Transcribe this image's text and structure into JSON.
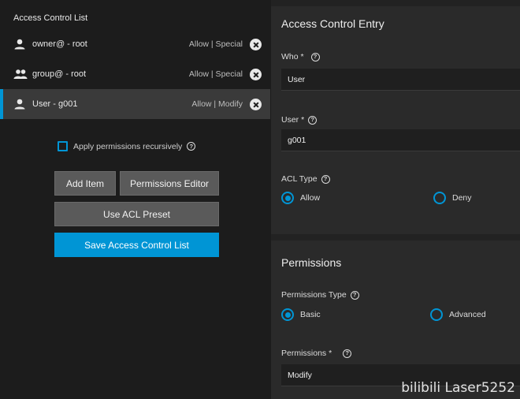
{
  "left": {
    "title": "Access Control List",
    "items": [
      {
        "name": "owner@ - root",
        "perm": "Allow | Special",
        "icon": "person-icon"
      },
      {
        "name": "group@ - root",
        "perm": "Allow | Special",
        "icon": "group-icon"
      },
      {
        "name": "User - g001",
        "perm": "Allow | Modify",
        "icon": "person-icon"
      }
    ],
    "recursive_label": "Apply permissions recursively",
    "buttons": {
      "add_item": "Add Item",
      "permissions_editor": "Permissions Editor",
      "use_acl_preset": "Use ACL Preset",
      "save": "Save Access Control List"
    }
  },
  "entry": {
    "title": "Access Control Entry",
    "who_label": "Who *",
    "who_value": "User",
    "user_label": "User *",
    "user_value": "g001",
    "acl_type_label": "ACL Type",
    "acl_type_options": [
      "Allow",
      "Deny"
    ],
    "acl_type_selected": "Allow"
  },
  "permissions": {
    "title": "Permissions",
    "type_label": "Permissions Type",
    "type_options": [
      "Basic",
      "Advanced"
    ],
    "type_selected": "Basic",
    "perm_label": "Permissions *",
    "perm_value": "Modify"
  },
  "watermark": "bilibili Laser5252",
  "colors": {
    "accent": "#0095d5",
    "panel": "#1c1c1c",
    "card": "#2a2a2a"
  }
}
